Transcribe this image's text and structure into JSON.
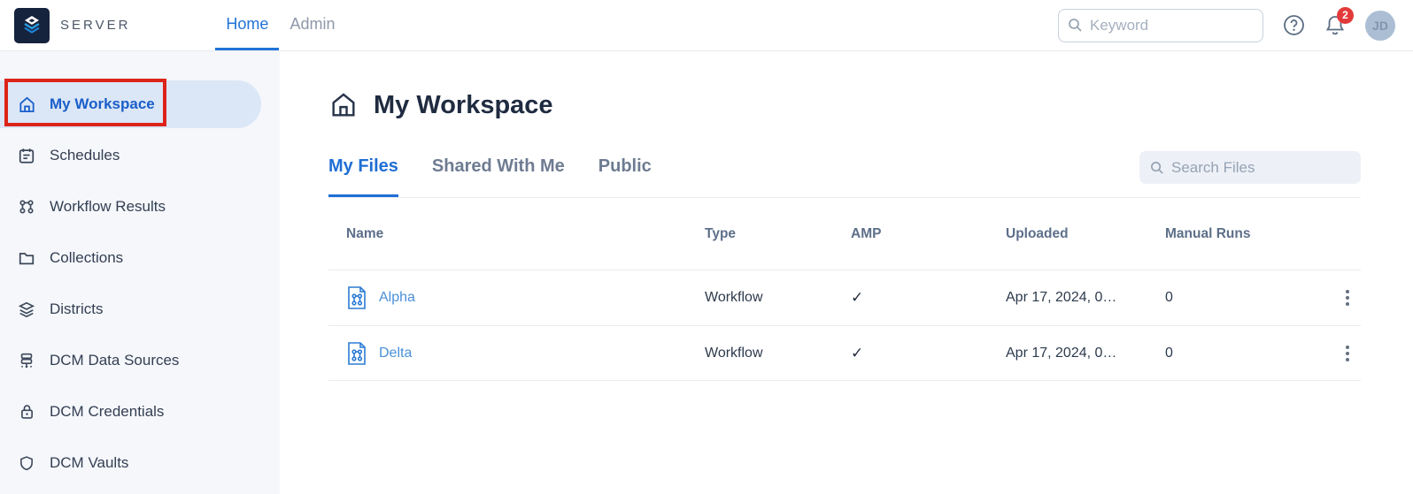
{
  "topbar": {
    "logo_text": "SERVER",
    "nav": [
      {
        "label": "Home"
      },
      {
        "label": "Admin"
      }
    ],
    "search_placeholder": "Keyword",
    "notification_count": "2",
    "avatar_initials": "JD"
  },
  "sidebar": {
    "items": [
      {
        "label": "My Workspace"
      },
      {
        "label": "Schedules"
      },
      {
        "label": "Workflow Results"
      },
      {
        "label": "Collections"
      },
      {
        "label": "Districts"
      },
      {
        "label": "DCM Data Sources"
      },
      {
        "label": "DCM Credentials"
      },
      {
        "label": "DCM Vaults"
      }
    ],
    "active_item": "My Workspace"
  },
  "main": {
    "title": "My Workspace",
    "tabs": [
      {
        "label": "My Files"
      },
      {
        "label": "Shared With Me"
      },
      {
        "label": "Public"
      }
    ],
    "active_tab": "My Files",
    "search_placeholder": "Search Files",
    "table": {
      "columns": [
        "Name",
        "Type",
        "AMP",
        "Uploaded",
        "Manual Runs"
      ],
      "rows": [
        {
          "name": "Alpha",
          "type": "Workflow",
          "amp": "✓",
          "uploaded": "Apr 17, 2024, 0…",
          "manual_runs": "0"
        },
        {
          "name": "Delta",
          "type": "Workflow",
          "amp": "✓",
          "uploaded": "Apr 17, 2024, 0…",
          "manual_runs": "0"
        }
      ]
    }
  },
  "colors": {
    "accent_blue": "#1f6ed4",
    "link_blue": "#4a90d9",
    "annotation_red": "#dd2419",
    "badge_red": "#e23a3a",
    "sidebar_bg": "#f5f7fb",
    "active_pill_bg": "#dbe7f6"
  }
}
